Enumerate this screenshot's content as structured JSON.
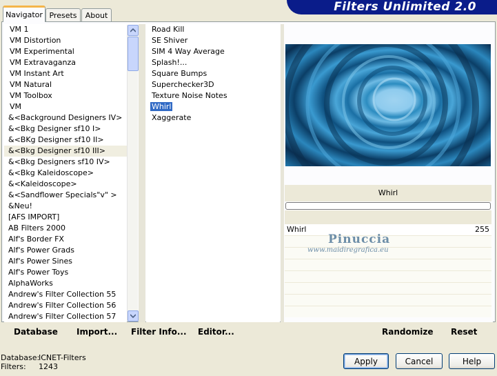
{
  "tabs": [
    {
      "label": "Navigator"
    },
    {
      "label": "Presets"
    },
    {
      "label": "About"
    }
  ],
  "app_title": "Filters Unlimited 2.0",
  "categories": [
    "VM 1",
    "VM Distortion",
    "VM Experimental",
    "VM Extravaganza",
    "VM Instant Art",
    "VM Natural",
    "VM Toolbox",
    "VM",
    "&<Background Designers IV>",
    "&<Bkg Designer sf10 I>",
    "&<BKg Designer sf10 II>",
    "&<Bkg Designer sf10 III>",
    "&<Bkg Designers sf10 IV>",
    "&<Bkg Kaleidoscope>",
    "&<Kaleidoscope>",
    "&<Sandflower Specials\"v\" >",
    "&Neu!",
    "[AFS IMPORT]",
    "AB Filters 2000",
    "Alf's Border FX",
    "Alf's Power Grads",
    "Alf's Power Sines",
    "Alf's Power Toys",
    "AlphaWorks",
    "Andrew's Filter Collection 55",
    "Andrew's Filter Collection 56",
    "Andrew's Filter Collection 57"
  ],
  "filters": [
    "Road Kill",
    "SE Shiver",
    "SIM 4 Way Average",
    "Splash!...",
    "Square Bumps",
    "Superchecker3D",
    "Texture Noise Notes",
    "Whirl",
    "Xaggerate"
  ],
  "preview": {
    "filter_name": "Whirl",
    "param_label": "Whirl",
    "param_value": "255"
  },
  "watermark": {
    "name": "Pinuccia",
    "site": "www.maidiregrafica.eu"
  },
  "links": {
    "database": "Database",
    "import": "Import...",
    "filter_info": "Filter Info...",
    "editor": "Editor...",
    "randomize": "Randomize",
    "reset": "Reset"
  },
  "buttons": {
    "apply": "Apply",
    "cancel": "Cancel",
    "help": "Help"
  },
  "status": {
    "database_label": "Database:",
    "database_value": "ICNET-Filters",
    "filters_label": "Filters:",
    "filters_value": "1243"
  },
  "colors": {
    "banner": "#0a1c8a",
    "selection": "#316ac5"
  }
}
